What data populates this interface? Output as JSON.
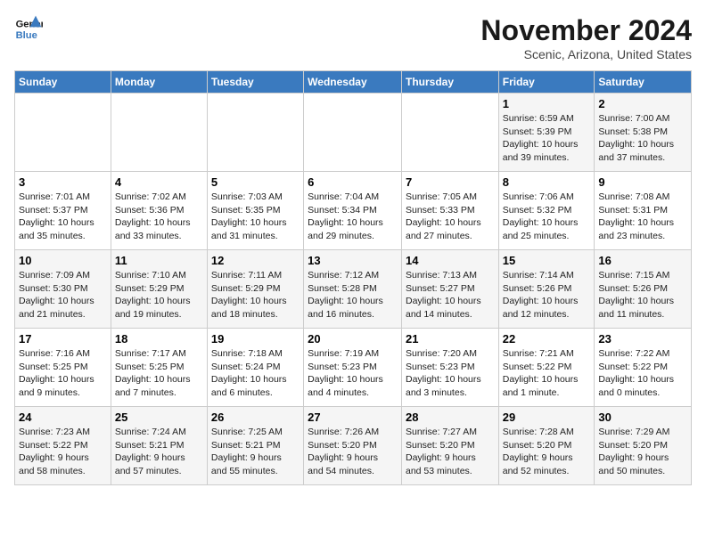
{
  "logo": {
    "line1": "General",
    "line2": "Blue"
  },
  "title": "November 2024",
  "subtitle": "Scenic, Arizona, United States",
  "weekdays": [
    "Sunday",
    "Monday",
    "Tuesday",
    "Wednesday",
    "Thursday",
    "Friday",
    "Saturday"
  ],
  "weeks": [
    [
      {
        "day": "",
        "info": ""
      },
      {
        "day": "",
        "info": ""
      },
      {
        "day": "",
        "info": ""
      },
      {
        "day": "",
        "info": ""
      },
      {
        "day": "",
        "info": ""
      },
      {
        "day": "1",
        "info": "Sunrise: 6:59 AM\nSunset: 5:39 PM\nDaylight: 10 hours\nand 39 minutes."
      },
      {
        "day": "2",
        "info": "Sunrise: 7:00 AM\nSunset: 5:38 PM\nDaylight: 10 hours\nand 37 minutes."
      }
    ],
    [
      {
        "day": "3",
        "info": "Sunrise: 7:01 AM\nSunset: 5:37 PM\nDaylight: 10 hours\nand 35 minutes."
      },
      {
        "day": "4",
        "info": "Sunrise: 7:02 AM\nSunset: 5:36 PM\nDaylight: 10 hours\nand 33 minutes."
      },
      {
        "day": "5",
        "info": "Sunrise: 7:03 AM\nSunset: 5:35 PM\nDaylight: 10 hours\nand 31 minutes."
      },
      {
        "day": "6",
        "info": "Sunrise: 7:04 AM\nSunset: 5:34 PM\nDaylight: 10 hours\nand 29 minutes."
      },
      {
        "day": "7",
        "info": "Sunrise: 7:05 AM\nSunset: 5:33 PM\nDaylight: 10 hours\nand 27 minutes."
      },
      {
        "day": "8",
        "info": "Sunrise: 7:06 AM\nSunset: 5:32 PM\nDaylight: 10 hours\nand 25 minutes."
      },
      {
        "day": "9",
        "info": "Sunrise: 7:08 AM\nSunset: 5:31 PM\nDaylight: 10 hours\nand 23 minutes."
      }
    ],
    [
      {
        "day": "10",
        "info": "Sunrise: 7:09 AM\nSunset: 5:30 PM\nDaylight: 10 hours\nand 21 minutes."
      },
      {
        "day": "11",
        "info": "Sunrise: 7:10 AM\nSunset: 5:29 PM\nDaylight: 10 hours\nand 19 minutes."
      },
      {
        "day": "12",
        "info": "Sunrise: 7:11 AM\nSunset: 5:29 PM\nDaylight: 10 hours\nand 18 minutes."
      },
      {
        "day": "13",
        "info": "Sunrise: 7:12 AM\nSunset: 5:28 PM\nDaylight: 10 hours\nand 16 minutes."
      },
      {
        "day": "14",
        "info": "Sunrise: 7:13 AM\nSunset: 5:27 PM\nDaylight: 10 hours\nand 14 minutes."
      },
      {
        "day": "15",
        "info": "Sunrise: 7:14 AM\nSunset: 5:26 PM\nDaylight: 10 hours\nand 12 minutes."
      },
      {
        "day": "16",
        "info": "Sunrise: 7:15 AM\nSunset: 5:26 PM\nDaylight: 10 hours\nand 11 minutes."
      }
    ],
    [
      {
        "day": "17",
        "info": "Sunrise: 7:16 AM\nSunset: 5:25 PM\nDaylight: 10 hours\nand 9 minutes."
      },
      {
        "day": "18",
        "info": "Sunrise: 7:17 AM\nSunset: 5:25 PM\nDaylight: 10 hours\nand 7 minutes."
      },
      {
        "day": "19",
        "info": "Sunrise: 7:18 AM\nSunset: 5:24 PM\nDaylight: 10 hours\nand 6 minutes."
      },
      {
        "day": "20",
        "info": "Sunrise: 7:19 AM\nSunset: 5:23 PM\nDaylight: 10 hours\nand 4 minutes."
      },
      {
        "day": "21",
        "info": "Sunrise: 7:20 AM\nSunset: 5:23 PM\nDaylight: 10 hours\nand 3 minutes."
      },
      {
        "day": "22",
        "info": "Sunrise: 7:21 AM\nSunset: 5:22 PM\nDaylight: 10 hours\nand 1 minute."
      },
      {
        "day": "23",
        "info": "Sunrise: 7:22 AM\nSunset: 5:22 PM\nDaylight: 10 hours\nand 0 minutes."
      }
    ],
    [
      {
        "day": "24",
        "info": "Sunrise: 7:23 AM\nSunset: 5:22 PM\nDaylight: 9 hours\nand 58 minutes."
      },
      {
        "day": "25",
        "info": "Sunrise: 7:24 AM\nSunset: 5:21 PM\nDaylight: 9 hours\nand 57 minutes."
      },
      {
        "day": "26",
        "info": "Sunrise: 7:25 AM\nSunset: 5:21 PM\nDaylight: 9 hours\nand 55 minutes."
      },
      {
        "day": "27",
        "info": "Sunrise: 7:26 AM\nSunset: 5:20 PM\nDaylight: 9 hours\nand 54 minutes."
      },
      {
        "day": "28",
        "info": "Sunrise: 7:27 AM\nSunset: 5:20 PM\nDaylight: 9 hours\nand 53 minutes."
      },
      {
        "day": "29",
        "info": "Sunrise: 7:28 AM\nSunset: 5:20 PM\nDaylight: 9 hours\nand 52 minutes."
      },
      {
        "day": "30",
        "info": "Sunrise: 7:29 AM\nSunset: 5:20 PM\nDaylight: 9 hours\nand 50 minutes."
      }
    ]
  ]
}
